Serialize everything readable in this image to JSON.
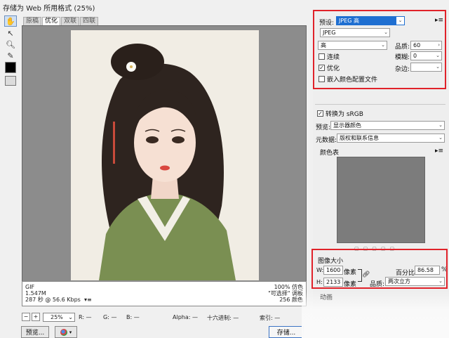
{
  "window": {
    "title": "存储为 Web 所用格式 (25%)"
  },
  "tabs": [
    {
      "label": "原稿"
    },
    {
      "label": "优化"
    },
    {
      "label": "双联"
    },
    {
      "label": "四联"
    }
  ],
  "image_info": {
    "format": "GIF",
    "filesize": "1.547M",
    "download_time": "287 秒 @ 56.6 Kbps",
    "dither": "100% 仿色",
    "palette": "\"可选择\" 调板",
    "colors": "256 颜色"
  },
  "statusbar": {
    "zoom": "25%",
    "r": "R: —",
    "g": "G: —",
    "b": "B: —",
    "alpha": "Alpha: —",
    "hex": "十六进制: —",
    "index": "索引: —"
  },
  "buttons": {
    "preview": "预览...",
    "save": "存储..."
  },
  "settings": {
    "preset_label": "预设:",
    "preset_value": "JPEG 高",
    "format_value": "JPEG",
    "quality_preset": "高",
    "quality_label": "品质:",
    "quality_value": "60",
    "progressive_label": "连续",
    "blur_label": "模糊:",
    "blur_value": "0",
    "optimized_label": "优化",
    "matte_label": "杂边:",
    "embed_profile_label": "嵌入颜色配置文件",
    "convert_srgb_label": "转换为 sRGB",
    "preview_label": "预览:",
    "preview_value": "显示器颜色",
    "metadata_label": "元数据:",
    "metadata_value": "版权和联系信息",
    "color_table_label": "颜色表"
  },
  "image_size": {
    "section_label": "图像大小",
    "w_label": "W:",
    "w_value": "1600",
    "h_label": "H:",
    "h_value": "2133",
    "unit": "像素",
    "percent_label": "百分比:",
    "percent_value": "86.58",
    "percent_unit": "%",
    "quality_label": "品质:",
    "quality_value": "两次立方"
  },
  "animation": {
    "label": "动画"
  },
  "colors": {
    "highlight": "#e0222a",
    "selection": "#1f6fd1",
    "canvas_bg": "#8c8c8c",
    "color_table": "#7c7c7c"
  }
}
